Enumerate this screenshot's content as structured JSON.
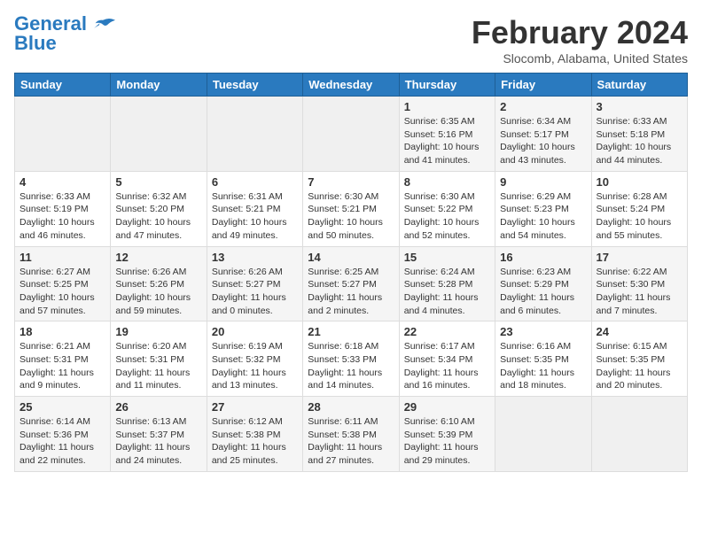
{
  "logo": {
    "line1": "General",
    "line2": "Blue"
  },
  "title": "February 2024",
  "location": "Slocomb, Alabama, United States",
  "days_of_week": [
    "Sunday",
    "Monday",
    "Tuesday",
    "Wednesday",
    "Thursday",
    "Friday",
    "Saturday"
  ],
  "weeks": [
    [
      {
        "day": "",
        "info": ""
      },
      {
        "day": "",
        "info": ""
      },
      {
        "day": "",
        "info": ""
      },
      {
        "day": "",
        "info": ""
      },
      {
        "day": "1",
        "info": "Sunrise: 6:35 AM\nSunset: 5:16 PM\nDaylight: 10 hours\nand 41 minutes."
      },
      {
        "day": "2",
        "info": "Sunrise: 6:34 AM\nSunset: 5:17 PM\nDaylight: 10 hours\nand 43 minutes."
      },
      {
        "day": "3",
        "info": "Sunrise: 6:33 AM\nSunset: 5:18 PM\nDaylight: 10 hours\nand 44 minutes."
      }
    ],
    [
      {
        "day": "4",
        "info": "Sunrise: 6:33 AM\nSunset: 5:19 PM\nDaylight: 10 hours\nand 46 minutes."
      },
      {
        "day": "5",
        "info": "Sunrise: 6:32 AM\nSunset: 5:20 PM\nDaylight: 10 hours\nand 47 minutes."
      },
      {
        "day": "6",
        "info": "Sunrise: 6:31 AM\nSunset: 5:21 PM\nDaylight: 10 hours\nand 49 minutes."
      },
      {
        "day": "7",
        "info": "Sunrise: 6:30 AM\nSunset: 5:21 PM\nDaylight: 10 hours\nand 50 minutes."
      },
      {
        "day": "8",
        "info": "Sunrise: 6:30 AM\nSunset: 5:22 PM\nDaylight: 10 hours\nand 52 minutes."
      },
      {
        "day": "9",
        "info": "Sunrise: 6:29 AM\nSunset: 5:23 PM\nDaylight: 10 hours\nand 54 minutes."
      },
      {
        "day": "10",
        "info": "Sunrise: 6:28 AM\nSunset: 5:24 PM\nDaylight: 10 hours\nand 55 minutes."
      }
    ],
    [
      {
        "day": "11",
        "info": "Sunrise: 6:27 AM\nSunset: 5:25 PM\nDaylight: 10 hours\nand 57 minutes."
      },
      {
        "day": "12",
        "info": "Sunrise: 6:26 AM\nSunset: 5:26 PM\nDaylight: 10 hours\nand 59 minutes."
      },
      {
        "day": "13",
        "info": "Sunrise: 6:26 AM\nSunset: 5:27 PM\nDaylight: 11 hours\nand 0 minutes."
      },
      {
        "day": "14",
        "info": "Sunrise: 6:25 AM\nSunset: 5:27 PM\nDaylight: 11 hours\nand 2 minutes."
      },
      {
        "day": "15",
        "info": "Sunrise: 6:24 AM\nSunset: 5:28 PM\nDaylight: 11 hours\nand 4 minutes."
      },
      {
        "day": "16",
        "info": "Sunrise: 6:23 AM\nSunset: 5:29 PM\nDaylight: 11 hours\nand 6 minutes."
      },
      {
        "day": "17",
        "info": "Sunrise: 6:22 AM\nSunset: 5:30 PM\nDaylight: 11 hours\nand 7 minutes."
      }
    ],
    [
      {
        "day": "18",
        "info": "Sunrise: 6:21 AM\nSunset: 5:31 PM\nDaylight: 11 hours\nand 9 minutes."
      },
      {
        "day": "19",
        "info": "Sunrise: 6:20 AM\nSunset: 5:31 PM\nDaylight: 11 hours\nand 11 minutes."
      },
      {
        "day": "20",
        "info": "Sunrise: 6:19 AM\nSunset: 5:32 PM\nDaylight: 11 hours\nand 13 minutes."
      },
      {
        "day": "21",
        "info": "Sunrise: 6:18 AM\nSunset: 5:33 PM\nDaylight: 11 hours\nand 14 minutes."
      },
      {
        "day": "22",
        "info": "Sunrise: 6:17 AM\nSunset: 5:34 PM\nDaylight: 11 hours\nand 16 minutes."
      },
      {
        "day": "23",
        "info": "Sunrise: 6:16 AM\nSunset: 5:35 PM\nDaylight: 11 hours\nand 18 minutes."
      },
      {
        "day": "24",
        "info": "Sunrise: 6:15 AM\nSunset: 5:35 PM\nDaylight: 11 hours\nand 20 minutes."
      }
    ],
    [
      {
        "day": "25",
        "info": "Sunrise: 6:14 AM\nSunset: 5:36 PM\nDaylight: 11 hours\nand 22 minutes."
      },
      {
        "day": "26",
        "info": "Sunrise: 6:13 AM\nSunset: 5:37 PM\nDaylight: 11 hours\nand 24 minutes."
      },
      {
        "day": "27",
        "info": "Sunrise: 6:12 AM\nSunset: 5:38 PM\nDaylight: 11 hours\nand 25 minutes."
      },
      {
        "day": "28",
        "info": "Sunrise: 6:11 AM\nSunset: 5:38 PM\nDaylight: 11 hours\nand 27 minutes."
      },
      {
        "day": "29",
        "info": "Sunrise: 6:10 AM\nSunset: 5:39 PM\nDaylight: 11 hours\nand 29 minutes."
      },
      {
        "day": "",
        "info": ""
      },
      {
        "day": "",
        "info": ""
      }
    ]
  ]
}
